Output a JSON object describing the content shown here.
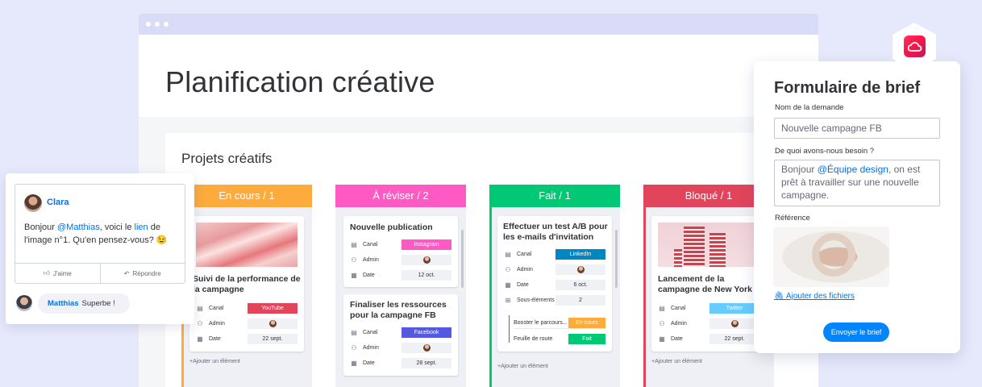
{
  "page": {
    "title": "Planification créative"
  },
  "board": {
    "title": "Projets créatifs",
    "add_item_label": "+Ajouter un élément",
    "columns": [
      {
        "title": "En cours / 1",
        "color": "#fdab3d",
        "cards": [
          {
            "title": "Suivi de la performance de la campagne",
            "fields": [
              {
                "label": "Canal",
                "value": "YouTube",
                "color": "#e2445c"
              },
              {
                "label": "Admin",
                "value": ""
              },
              {
                "label": "Date",
                "value": "22 sept."
              }
            ]
          }
        ]
      },
      {
        "title": "À réviser / 2",
        "color": "#ff5ac4",
        "cards": [
          {
            "title": "Nouvelle publication",
            "fields": [
              {
                "label": "Canal",
                "value": "Instagram",
                "color": "#ff5ac4"
              },
              {
                "label": "Admin",
                "value": ""
              },
              {
                "label": "Date",
                "value": "12 oct."
              }
            ]
          },
          {
            "title": "Finaliser les ressources pour la campagne FB",
            "fields": [
              {
                "label": "Canal",
                "value": "Facebook",
                "color": "#5559df"
              },
              {
                "label": "Admin",
                "value": ""
              },
              {
                "label": "Date",
                "value": "28 sept."
              }
            ]
          }
        ]
      },
      {
        "title": "Fait / 1",
        "color": "#00c875",
        "cards": [
          {
            "title": "Effectuer un test A/B pour les e-mails d'invitation",
            "fields": [
              {
                "label": "Canal",
                "value": "LinkedIn",
                "color": "#0086c0"
              },
              {
                "label": "Admin",
                "value": ""
              },
              {
                "label": "Date",
                "value": "6 oct."
              },
              {
                "label": "Sous-éléments",
                "value": "2"
              }
            ],
            "subitems": [
              {
                "label": "Booster le parcours...",
                "status": "En cours",
                "color": "#fdab3d"
              },
              {
                "label": "Feuille de route",
                "status": "Fait",
                "color": "#00c875"
              }
            ]
          }
        ]
      },
      {
        "title": "Bloqué / 1",
        "color": "#e2445c",
        "cards": [
          {
            "title": "Lancement de la campagne de New York",
            "fields": [
              {
                "label": "Canal",
                "value": "Twitter",
                "color": "#66ccff"
              },
              {
                "label": "Admin",
                "value": ""
              },
              {
                "label": "Date",
                "value": "22 sept."
              }
            ]
          }
        ]
      }
    ]
  },
  "comment": {
    "author": "Clara",
    "text_before": "Bonjour ",
    "mention": "@Matthias",
    "text_middle": ", voici le ",
    "link": "lien",
    "text_after": " de l'image n°1. Qu'en pensez-vous? 😉",
    "like_label": "J'aime",
    "reply_label": "Répondre",
    "reply": {
      "author": "Matthias",
      "text": "Superbe !"
    }
  },
  "form": {
    "title": "Formulaire de brief",
    "name_label": "Nom de la demande",
    "name_value": "Nouvelle campagne FB",
    "need_label": "De quoi avons-nous besoin ?",
    "need_before": "Bonjour ",
    "need_mention": "@Équipe design",
    "need_after": ", on est prêt à travailler sur une nouvelle campagne.",
    "ref_label": "Référence",
    "attach_label": "Ajouter des fichiers",
    "submit_label": "Envoyer le brief"
  }
}
